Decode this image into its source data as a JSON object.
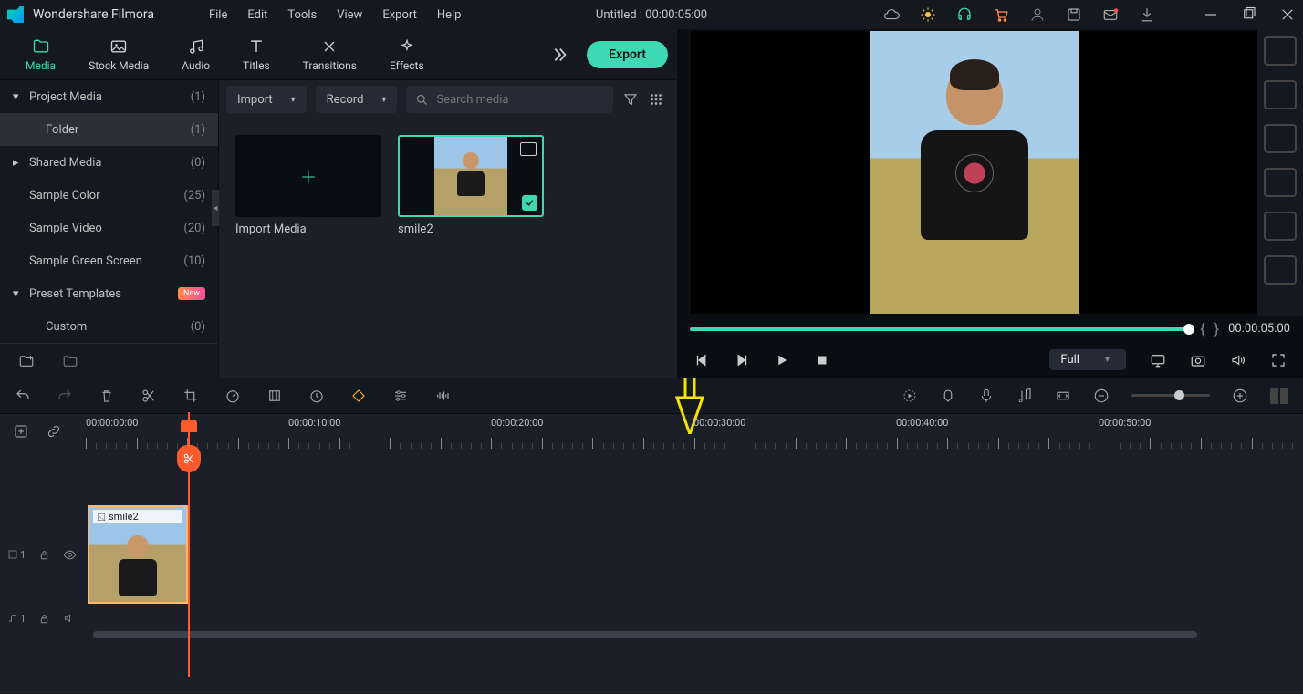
{
  "app": {
    "name": "Wondershare Filmora",
    "title": "Untitled : 00:00:05:00"
  },
  "menubar": [
    "File",
    "Edit",
    "Tools",
    "View",
    "Export",
    "Help"
  ],
  "top_tabs": [
    {
      "label": "Media",
      "icon": "folder"
    },
    {
      "label": "Stock Media",
      "icon": "image"
    },
    {
      "label": "Audio",
      "icon": "music"
    },
    {
      "label": "Titles",
      "icon": "text"
    },
    {
      "label": "Transitions",
      "icon": "swap"
    },
    {
      "label": "Effects",
      "icon": "sparkle"
    }
  ],
  "export_label": "Export",
  "sidebar": {
    "items": [
      {
        "label": "Project Media",
        "count": "(1)",
        "caret": "down",
        "indent": 0
      },
      {
        "label": "Folder",
        "count": "(1)",
        "selected": true,
        "indent": 1
      },
      {
        "label": "Shared Media",
        "count": "(0)",
        "caret": "right",
        "indent": 0
      },
      {
        "label": "Sample Color",
        "count": "(25)",
        "indent": 0
      },
      {
        "label": "Sample Video",
        "count": "(20)",
        "indent": 0
      },
      {
        "label": "Sample Green Screen",
        "count": "(10)",
        "indent": 0
      },
      {
        "label": "Preset Templates",
        "caret": "down",
        "badge": "New",
        "indent": 0
      },
      {
        "label": "Custom",
        "count": "(0)",
        "indent": 1
      }
    ]
  },
  "media_toolbar": {
    "import": "Import",
    "record": "Record",
    "search_placeholder": "Search media"
  },
  "media_items": [
    {
      "label": "Import Media",
      "type": "add"
    },
    {
      "label": "smile2",
      "type": "clip",
      "selected": true
    }
  ],
  "preview": {
    "timecode": "00:00:05:00",
    "quality": "Full"
  },
  "timeline": {
    "ruler": [
      "00:00:00:00",
      "00:00:10:00",
      "00:00:20:00",
      "00:00:30:00",
      "00:00:40:00",
      "00:00:50:00"
    ],
    "video_track": "1",
    "audio_track": "1",
    "clip_label": "smile2"
  },
  "colors": {
    "accent": "#3dd9b4",
    "playhead": "#ff5a2c",
    "panel": "#1a1f28",
    "bg": "#14181f"
  }
}
